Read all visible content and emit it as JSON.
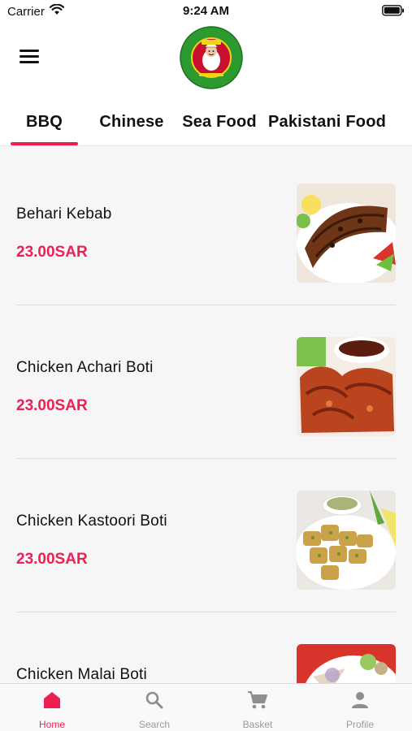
{
  "status_bar": {
    "carrier": "Carrier",
    "time": "9:24 AM"
  },
  "header": {
    "menu_icon": "hamburger-menu-icon",
    "logo": "restaurant-logo"
  },
  "tabs": [
    {
      "label": "BBQ",
      "active": true
    },
    {
      "label": "Chinese",
      "active": false
    },
    {
      "label": "Sea Food",
      "active": false
    },
    {
      "label": "Pakistani Food",
      "active": false
    }
  ],
  "items": [
    {
      "name": "Behari Kebab",
      "price": "23.00SAR"
    },
    {
      "name": "Chicken Achari Boti",
      "price": "23.00SAR"
    },
    {
      "name": "Chicken Kastoori Boti",
      "price": "23.00SAR"
    },
    {
      "name": "Chicken Malai Boti",
      "price": ""
    }
  ],
  "bottom_nav": [
    {
      "label": "Home",
      "icon": "home-icon",
      "active": true
    },
    {
      "label": "Search",
      "icon": "search-icon",
      "active": false
    },
    {
      "label": "Basket",
      "icon": "cart-icon",
      "active": false
    },
    {
      "label": "Profile",
      "icon": "profile-icon",
      "active": false
    }
  ],
  "colors": {
    "accent": "#ec2055",
    "nav_inactive": "#9a9a9a",
    "logo_green": "#2c9a2f",
    "logo_red": "#c8102e"
  }
}
